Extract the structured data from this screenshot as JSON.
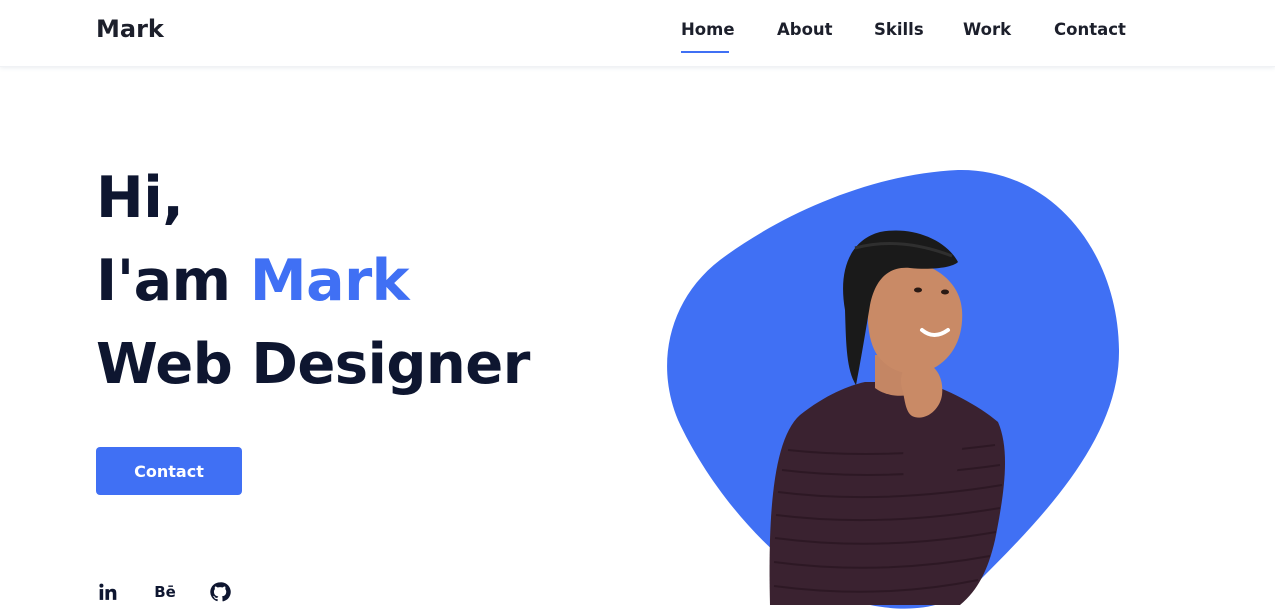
{
  "header": {
    "logo": "Mark",
    "nav": [
      {
        "label": "Home",
        "active": true
      },
      {
        "label": "About",
        "active": false
      },
      {
        "label": "Skills",
        "active": false
      },
      {
        "label": "Work",
        "active": false
      },
      {
        "label": "Contact",
        "active": false
      }
    ]
  },
  "hero": {
    "greeting": "Hi,",
    "intro_prefix": "I'am",
    "name": "Mark",
    "role": "Web Designer",
    "cta_label": "Contact"
  },
  "social": {
    "linkedin_icon": "linkedin-icon",
    "behance_label": "Bē",
    "github_icon": "github-icon"
  },
  "colors": {
    "accent": "#4070f4",
    "text_dark": "#0e1630"
  }
}
